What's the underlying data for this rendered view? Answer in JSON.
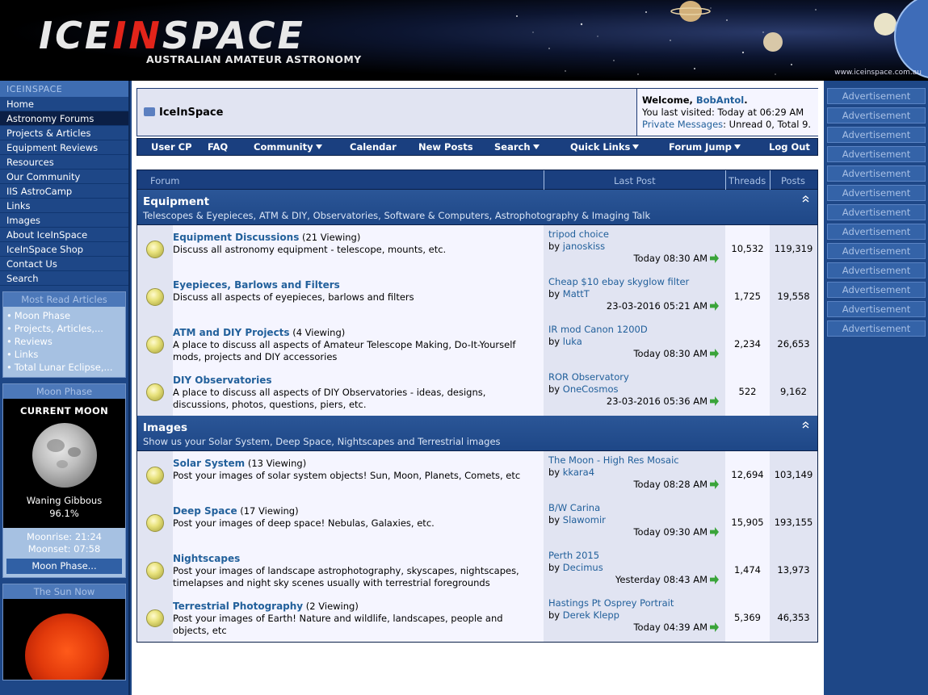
{
  "header": {
    "logo_part1": "ICE",
    "logo_part2": "IN",
    "logo_part3": "SPACE",
    "logo_subtitle": "AUSTRALIAN AMATEUR ASTRONOMY",
    "site_url": "www.iceinspace.com.au"
  },
  "left_nav": {
    "heading": "ICEINSPACE",
    "items": [
      {
        "label": "Home",
        "active": false
      },
      {
        "label": "Astronomy Forums",
        "active": true
      },
      {
        "label": "Projects & Articles",
        "active": false
      },
      {
        "label": "Equipment Reviews",
        "active": false
      },
      {
        "label": "Resources",
        "active": false
      },
      {
        "label": "Our Community",
        "active": false
      },
      {
        "label": "IIS AstroCamp",
        "active": false
      },
      {
        "label": "Links",
        "active": false
      },
      {
        "label": "Images",
        "active": false
      },
      {
        "label": "About IceInSpace",
        "active": false
      },
      {
        "label": "IceInSpace Shop",
        "active": false
      },
      {
        "label": "Contact Us",
        "active": false
      },
      {
        "label": "Search",
        "active": false
      }
    ]
  },
  "most_read": {
    "heading": "Most Read Articles",
    "items": [
      "Moon Phase",
      "Projects, Articles,...",
      "Reviews",
      "Links",
      "Total Lunar Eclipse,..."
    ]
  },
  "moon": {
    "heading": "Moon Phase",
    "title": "CURRENT MOON",
    "phase": "Waning Gibbous",
    "percent": "96.1%",
    "moonrise": "Moonrise: 21:24",
    "moonset": "Moonset: 07:58",
    "button": "Moon Phase..."
  },
  "sun": {
    "heading": "The Sun Now"
  },
  "top": {
    "forum_title": "IceInSpace",
    "welcome_prefix": "Welcome, ",
    "username": "BobAntol",
    "welcome_suffix": ".",
    "last_visited": "You last visited: Today at 06:29 AM",
    "pm_link": "Private Messages",
    "pm_status": ": Unread 0, Total 9."
  },
  "navbar": {
    "user_cp": "User CP",
    "faq": "FAQ",
    "community": "Community",
    "calendar": "Calendar",
    "new_posts": "New Posts",
    "search": "Search",
    "quick_links": "Quick Links",
    "forum_jump": "Forum Jump",
    "log_out": "Log Out"
  },
  "columns": {
    "forum": "Forum",
    "last_post": "Last Post",
    "threads": "Threads",
    "posts": "Posts"
  },
  "categories": [
    {
      "title": "Equipment",
      "desc": "Telescopes & Eyepieces, ATM & DIY, Observatories, Software & Computers, Astrophotography & Imaging Talk",
      "forums": [
        {
          "name": "Equipment Discussions",
          "viewing": " (21 Viewing)",
          "desc": "Discuss all astronomy equipment - telescope, mounts, etc.",
          "lp_title": "tripod choice",
          "lp_by": "by ",
          "lp_user": "janoskiss",
          "lp_date": "Today 08:30 AM",
          "threads": "10,532",
          "posts": "119,319"
        },
        {
          "name": "Eyepieces, Barlows and Filters",
          "viewing": "",
          "desc": "Discuss all aspects of eyepieces, barlows and filters",
          "lp_title": "Cheap $10 ebay skyglow filter",
          "lp_by": "by ",
          "lp_user": "MattT",
          "lp_date": "23-03-2016 05:21 AM",
          "threads": "1,725",
          "posts": "19,558"
        },
        {
          "name": "ATM and DIY Projects",
          "viewing": " (4 Viewing)",
          "desc": "A place to discuss all aspects of Amateur Telescope Making, Do-It-Yourself mods, projects and DIY accessories",
          "lp_title": "IR mod Canon 1200D",
          "lp_by": "by ",
          "lp_user": "luka",
          "lp_date": "Today 08:30 AM",
          "threads": "2,234",
          "posts": "26,653"
        },
        {
          "name": "DIY Observatories",
          "viewing": "",
          "desc": "A place to discuss all aspects of DIY Observatories - ideas, designs, discussions, photos, questions, piers, etc.",
          "lp_title": "ROR Observatory",
          "lp_by": "by ",
          "lp_user": "OneCosmos",
          "lp_date": "23-03-2016 05:36 AM",
          "threads": "522",
          "posts": "9,162"
        }
      ]
    },
    {
      "title": "Images",
      "desc": "Show us your Solar System, Deep Space, Nightscapes and Terrestrial images",
      "forums": [
        {
          "name": "Solar System",
          "viewing": " (13 Viewing)",
          "desc": "Post your images of solar system objects! Sun, Moon, Planets, Comets, etc",
          "lp_title": "The Moon - High Res Mosaic",
          "lp_by": "by ",
          "lp_user": "kkara4",
          "lp_date": "Today 08:28 AM",
          "threads": "12,694",
          "posts": "103,149"
        },
        {
          "name": "Deep Space",
          "viewing": " (17 Viewing)",
          "desc": "Post your images of deep space! Nebulas, Galaxies, etc.",
          "lp_title": "B/W Carina",
          "lp_by": "by ",
          "lp_user": "Slawomir",
          "lp_date": "Today 09:30 AM",
          "threads": "15,905",
          "posts": "193,155"
        },
        {
          "name": "Nightscapes",
          "viewing": "",
          "desc": "Post your images of landscape astrophotography, skyscapes, nightscapes, timelapses and night sky scenes usually with terrestrial foregrounds",
          "lp_title": "Perth 2015",
          "lp_by": "by ",
          "lp_user": "Decimus",
          "lp_date": "Yesterday 08:43 AM",
          "threads": "1,474",
          "posts": "13,973"
        },
        {
          "name": "Terrestrial Photography",
          "viewing": " (2 Viewing)",
          "desc": "Post your images of Earth! Nature and wildlife, landscapes, people and objects, etc",
          "lp_title": "Hastings Pt Osprey Portrait",
          "lp_by": "by ",
          "lp_user": "Derek Klepp",
          "lp_date": "Today 04:39 AM",
          "threads": "5,369",
          "posts": "46,353"
        }
      ]
    }
  ],
  "ads": [
    "Advertisement",
    "Advertisement",
    "Advertisement",
    "Advertisement",
    "Advertisement",
    "Advertisement",
    "Advertisement",
    "Advertisement",
    "Advertisement",
    "Advertisement",
    "Advertisement",
    "Advertisement",
    "Advertisement"
  ],
  "colors": {
    "brand_red": "#e1241a",
    "nav_blue": "#1e4787",
    "link_blue": "#22609b",
    "row_light": "#f5f5ff",
    "row_alt": "#e1e4f2"
  }
}
